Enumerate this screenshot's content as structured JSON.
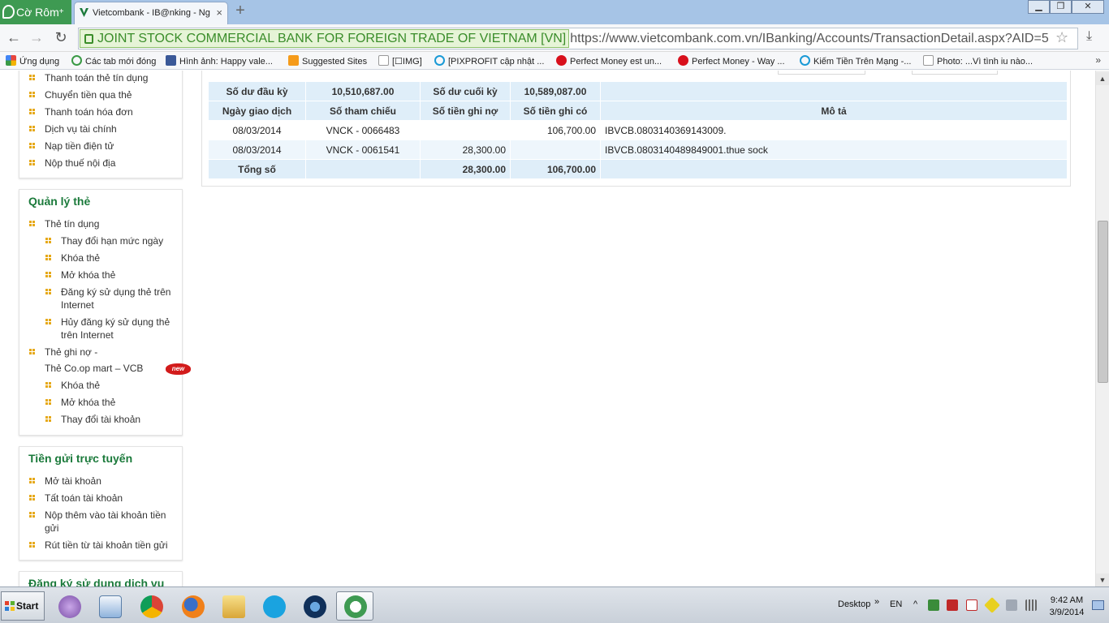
{
  "browser": {
    "brand": "Cờ Rôm",
    "brand_plus": "+",
    "tab_title": "Vietcombank - IB@nking - Ng",
    "tab_close": "×",
    "new_tab": "+",
    "window_buttons": [
      "▁",
      "❐",
      "✕"
    ],
    "ev_label": "JOINT STOCK COMMERCIAL BANK FOR FOREIGN TRADE OF VIETNAM [VN]",
    "url_scheme": "https://",
    "url_host": "www.vietcombank.com.vn",
    "url_path": "/IBanking/Accounts/TransactionDetail.aspx?AID=5",
    "nav": {
      "back": "←",
      "forward": "→",
      "reload": "↻"
    },
    "star": "☆",
    "download": "⤓"
  },
  "bookmarks": [
    {
      "label": "Ứng dụng",
      "color": "#e8453c"
    },
    {
      "label": "Các tab mới đóng",
      "color": "#3a9a45"
    },
    {
      "label": "Hình ảnh: Happy vale...",
      "color": "#3b5998"
    },
    {
      "label": "Suggested Sites",
      "color": "#f59b1a"
    },
    {
      "label": "[☐IMG]",
      "color": "#ffffff"
    },
    {
      "label": "[PIXPROFIT cập nhật ...",
      "color": "#1a9ad6"
    },
    {
      "label": "Perfect Money est un...",
      "color": "#d8101c"
    },
    {
      "label": "Perfect Money - Way ...",
      "color": "#d8101c"
    },
    {
      "label": "Kiếm Tiền Trên Mạng -...",
      "color": "#1a9ad6"
    },
    {
      "label": "Photo: ...Vì tình iu nào...",
      "color": "#ffffff"
    }
  ],
  "bookmarks_more": "»",
  "sidebar": {
    "panel1_items": [
      "Thanh toán thẻ tín dụng",
      "Chuyển tiền qua thẻ",
      "Thanh toán hóa đơn",
      "Dịch vụ tài chính",
      "Nạp tiền điện tử",
      "Nộp thuế nội địa"
    ],
    "card_title": "Quản lý thẻ",
    "card_credit": "Thẻ tín dụng",
    "card_credit_items": [
      "Thay đổi hạn mức ngày",
      "Khóa thẻ",
      "Mở khóa thẻ",
      "Đăng ký sử dụng thẻ trên Internet",
      "Hủy đăng ký sử dụng thẻ trên Internet"
    ],
    "card_debit": "Thẻ ghi nợ -",
    "card_coop": "Thẻ Co.op mart – VCB",
    "new_badge": "new",
    "card_debit_items": [
      "Khóa thẻ",
      "Mở khóa thẻ",
      "Thay đổi tài khoản"
    ],
    "deposit_title": "Tiền gửi trực tuyến",
    "deposit_items": [
      "Mở tài khoản",
      "Tất toán tài khoản",
      "Nộp thêm vào tài khoản tiền gửi",
      "Rút tiền từ tài khoản tiền gửi"
    ],
    "register_title": "Đăng ký sử dụng dịch vụ"
  },
  "statement": {
    "opening_label": "Số dư đầu kỳ",
    "opening_value": "10,510,687.00",
    "closing_label": "Số dư cuối kỳ",
    "closing_value": "10,589,087.00",
    "headers": [
      "Ngày giao dịch",
      "Số tham chiếu",
      "Số tiền ghi nợ",
      "Số tiền ghi có",
      "Mô tả"
    ],
    "rows": [
      {
        "date": "08/03/2014",
        "ref": "VNCK - 0066483",
        "debit": "",
        "credit": "106,700.00",
        "desc": "IBVCB.0803140369143009."
      },
      {
        "date": "08/03/2014",
        "ref": "VNCK - 0061541",
        "debit": "28,300.00",
        "credit": "",
        "desc": "IBVCB.0803140489849001.thue sock"
      }
    ],
    "total_label": "Tổng số",
    "total_debit": "28,300.00",
    "total_credit": "106,700.00"
  },
  "taskbar": {
    "start": "Start",
    "desktop": "Desktop",
    "lang": "EN",
    "time": "9:42 AM",
    "date": "3/9/2014",
    "expand": "»",
    "tray_up": "^"
  },
  "colors": {
    "accent_green": "#1b7a3b",
    "header_blue": "#dfeef9",
    "bullet": "#e6a817"
  }
}
